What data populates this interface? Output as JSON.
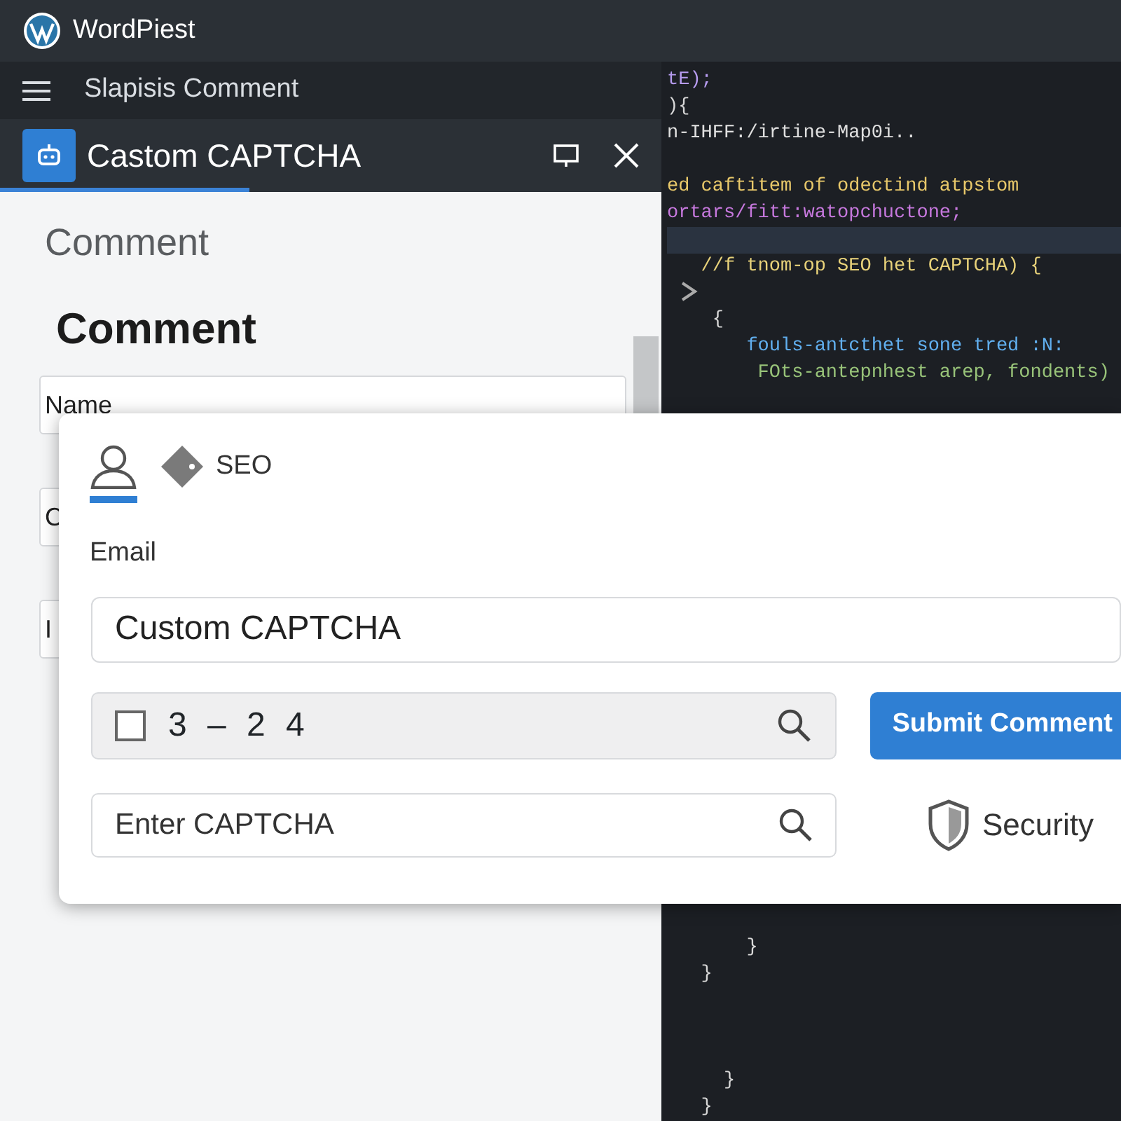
{
  "app": {
    "title": "WordPiest"
  },
  "toolbar": {
    "title": "Slapisis Comment"
  },
  "dialog": {
    "title": "Castom CAPTCHA"
  },
  "form": {
    "subtitle": "Comment",
    "heading": "Comment",
    "fields": [
      {
        "label": "Name"
      },
      {
        "label": "C"
      },
      {
        "label": "I"
      }
    ]
  },
  "editor": {
    "top_lines": [
      {
        "kind": "code",
        "text": "tE);",
        "color": "#b79cf0"
      },
      {
        "kind": "code",
        "text": "){",
        "color": "#d8d8d8"
      },
      {
        "kind": "code",
        "text": "n-IHFF:/irtine-Map0i..",
        "color": "#e0e0e0"
      },
      {
        "kind": "blank"
      },
      {
        "kind": "code",
        "text": "ed caftitem of odectind atpstom",
        "color": "#e8c86a"
      },
      {
        "kind": "code",
        "text": "ortars/fitt:watopchuctone;",
        "color": "#c678dd"
      },
      {
        "kind": "current"
      },
      {
        "kind": "code",
        "text": "   //f tnom-op SEO het CAPTCHA) {",
        "color": "#e8d27a"
      },
      {
        "kind": "fold"
      },
      {
        "kind": "code",
        "text": "    {",
        "color": "#d8d8d8"
      },
      {
        "kind": "code",
        "text": "       fouls-antcthet sone tred :N:",
        "color": "#61afef"
      },
      {
        "kind": "code",
        "text": "        FOts-antepnhest arep, fondents)",
        "color": "#98c379"
      }
    ],
    "bottom_lines": [
      {
        "kind": "code",
        "text": "       }",
        "color": "#d8d8d8"
      },
      {
        "kind": "code",
        "text": "   }",
        "color": "#d8d8d8"
      },
      {
        "kind": "blank"
      },
      {
        "kind": "blank"
      },
      {
        "kind": "blank"
      },
      {
        "kind": "code",
        "text": "     }",
        "color": "#d8d8d8"
      },
      {
        "kind": "code",
        "text": "   }",
        "color": "#d8d8d8"
      }
    ]
  },
  "popup": {
    "tabs": [
      {
        "kind": "person",
        "selected": true
      },
      {
        "kind": "tag",
        "label": "SEO",
        "selected": false
      }
    ],
    "email_label": "Email",
    "email_value": "Custom CAPTCHA",
    "captcha": {
      "checked": false,
      "code": "3 – 2 4"
    },
    "submit": "Submit Comment",
    "captcha_input": {
      "placeholder": "Enter CAPTCHA"
    },
    "security": "Security"
  }
}
